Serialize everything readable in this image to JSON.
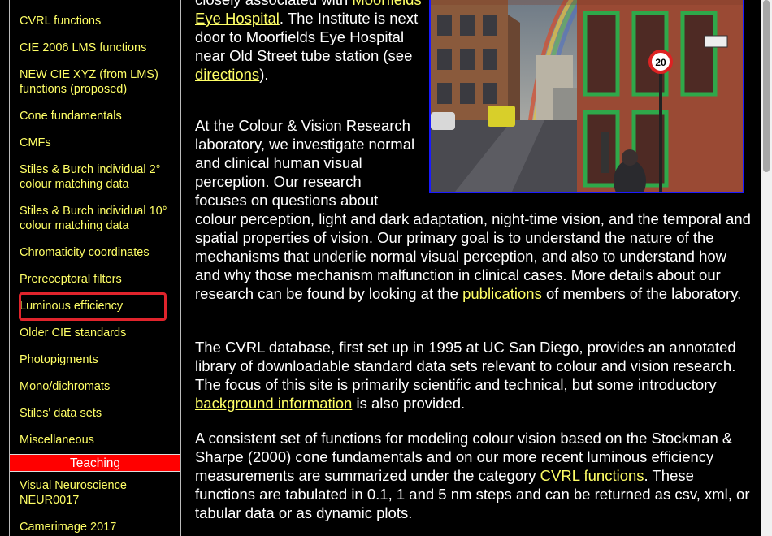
{
  "sidebar": {
    "items": [
      {
        "label": "CVRL functions"
      },
      {
        "label": "CIE 2006 LMS functions"
      },
      {
        "label": "NEW CIE XYZ (from LMS) functions (proposed)"
      },
      {
        "label": "Cone fundamentals"
      },
      {
        "label": "CMFs"
      },
      {
        "label": "Stiles & Burch individual 2° colour matching data"
      },
      {
        "label": "Stiles & Burch individual 10° colour matching data"
      },
      {
        "label": "Chromaticity coordinates"
      },
      {
        "label": "Prereceptoral filters"
      },
      {
        "label": "Luminous efficiency"
      },
      {
        "label": "Older CIE standards"
      },
      {
        "label": "Photopigments"
      },
      {
        "label": "Mono/dichromats"
      },
      {
        "label": "Stiles' data sets"
      },
      {
        "label": "Miscellaneous"
      }
    ],
    "teaching_header": "Teaching",
    "teaching_items": [
      {
        "label": "Visual Neuroscience NEUR0017"
      },
      {
        "label": "Camerimage 2017"
      }
    ]
  },
  "main": {
    "p1": {
      "part1": "closely associated with ",
      "link1": "Moorfields Eye Hospital",
      "part2": ". The Institute is next door to Moorfields Eye Hospital near Old Street tube station (see ",
      "link2": "directions",
      "part3": ")."
    },
    "p2": {
      "part1": "At the Colour & Vision Research laboratory, we investigate normal and clinical human visual perception. Our research focuses on questions about colour perception, light and dark adaptation, night-time vision, and the temporal and spatial properties of vision. Our primary goal is to understand the nature of the mechanisms that underlie normal visual perception, and also to understand how and why those mechanism malfunction in clinical cases. More details about our research can be found by looking at the ",
      "link": "publications",
      "part2": " of members of the laboratory."
    },
    "p3": {
      "part1": "The CVRL database, first set up in 1995 at UC San Diego, provides an annotated library of downloadable standard data sets relevant to colour and vision research. The focus of this site is primarily scientific and technical, but some introductory ",
      "link": "background information",
      "part2": " is also provided."
    },
    "p4": {
      "part1": "A consistent set of functions for modeling colour vision based on the Stockman & Sharpe (2000) cone fundamentals and on our more recent luminous efficiency measurements are summarized under the category ",
      "link": "CVRL functions",
      "part2": ". These functions are tabulated in 0.1, 1 and 5 nm steps and can be returned as csv, xml, or tabular data or as dynamic plots."
    }
  },
  "photo": {
    "sign_text": "20"
  },
  "colors": {
    "link": "#ffff66",
    "teaching_bg": "#ff0000",
    "highlight": "#e0242c",
    "photo_border": "#1a1aff"
  }
}
